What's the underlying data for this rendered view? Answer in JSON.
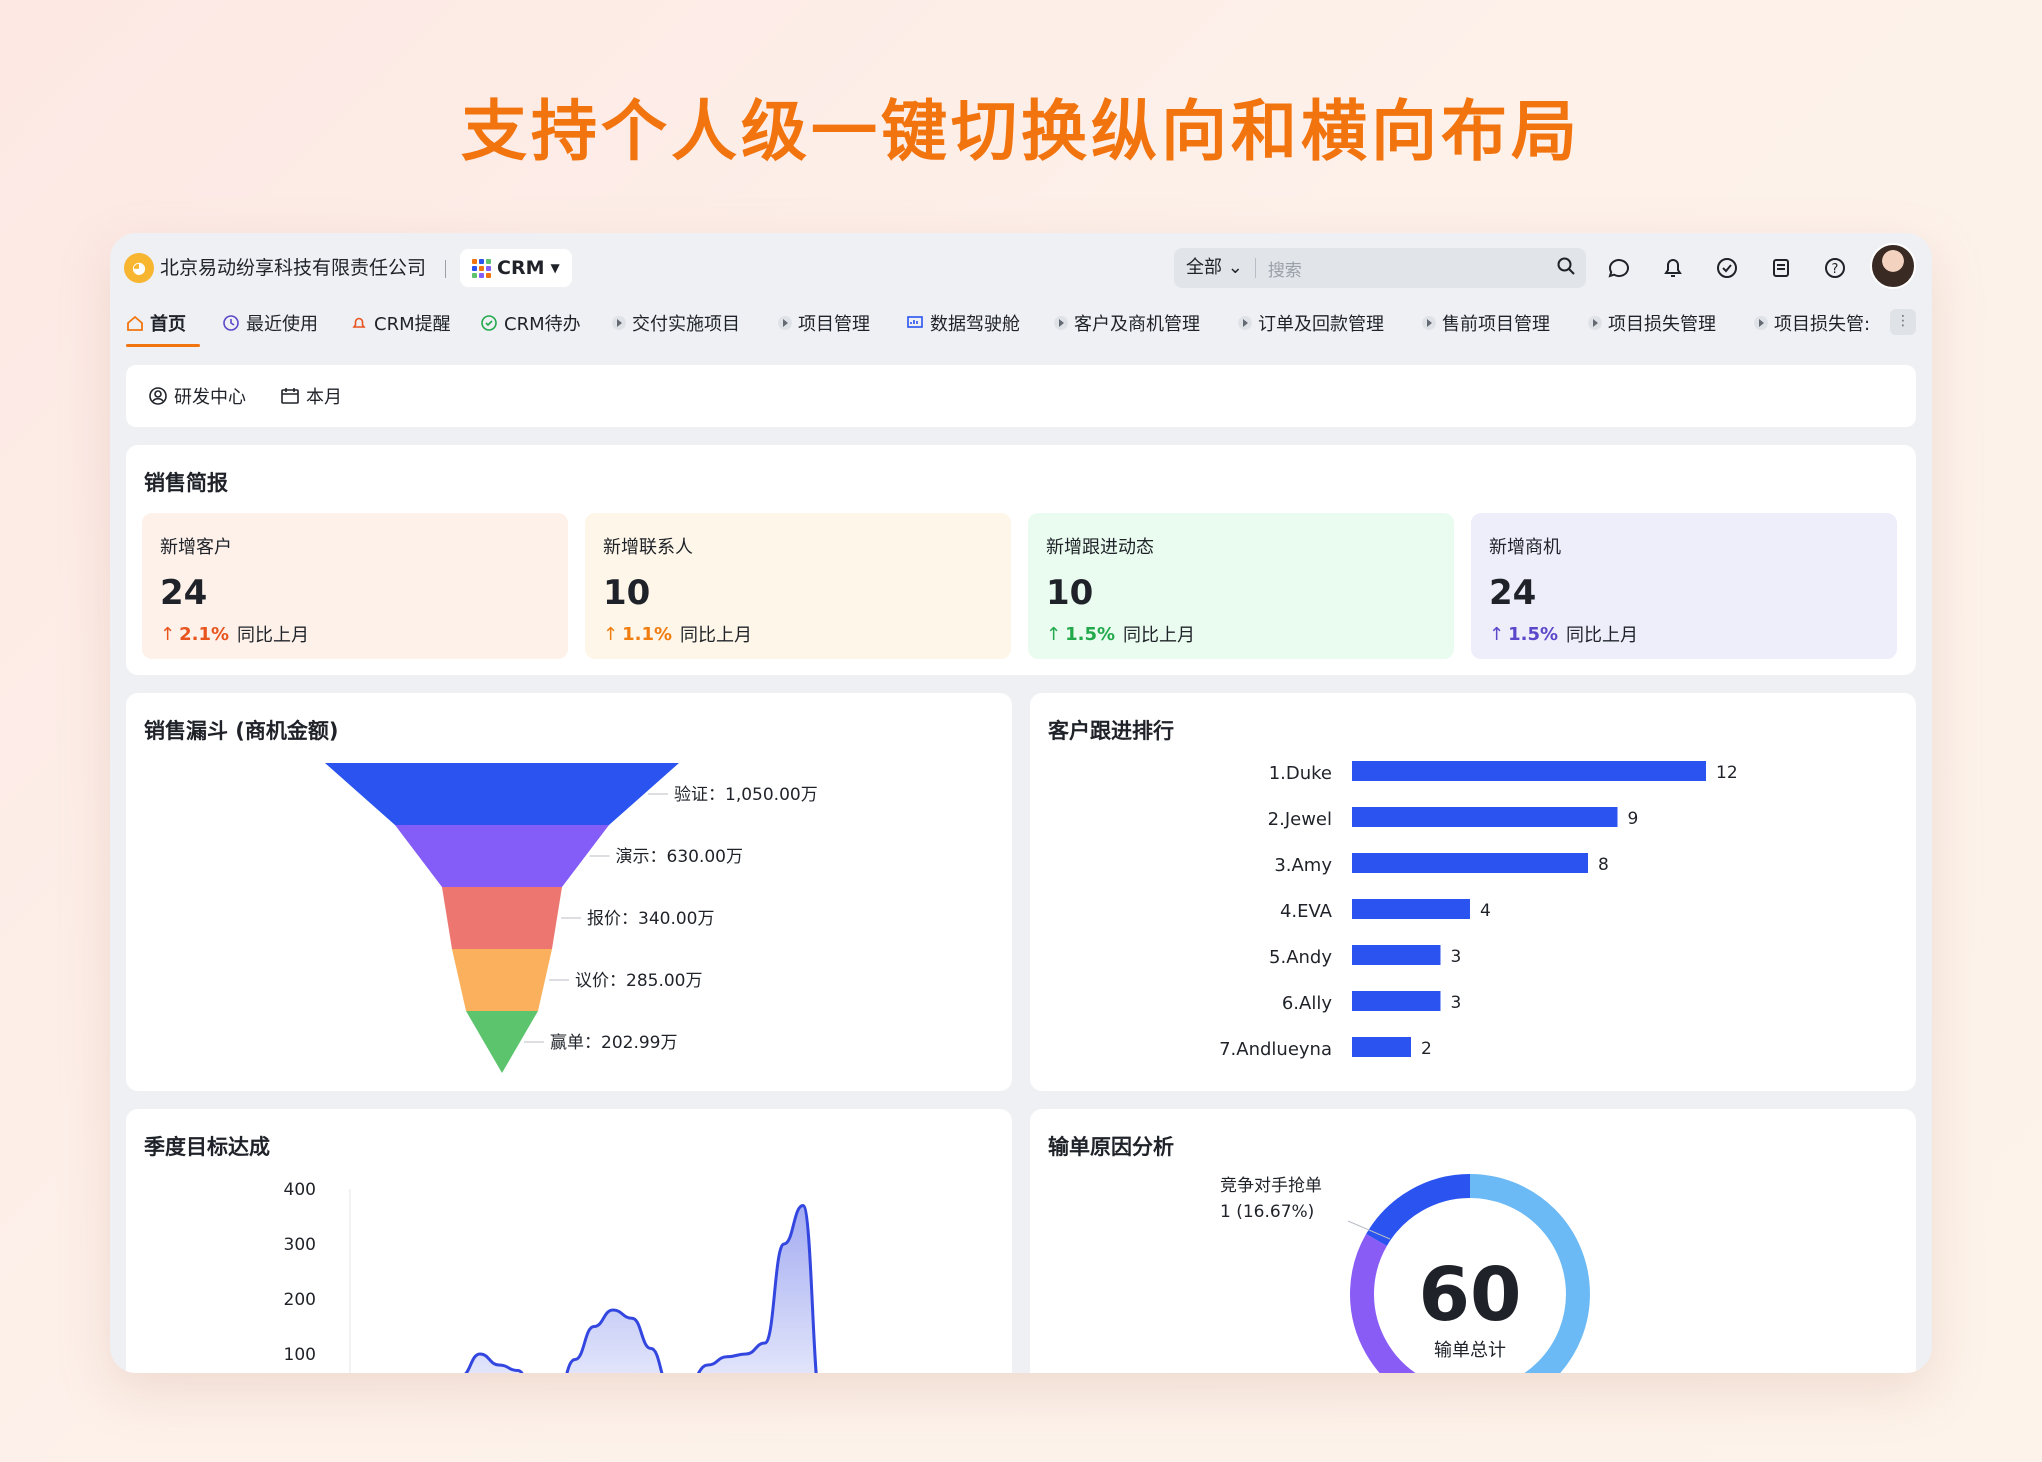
{
  "headline": "支持个人级一键切换纵向和横向布局",
  "topbar": {
    "company": "北京易动纷享科技有限责任公司",
    "app_label": "CRM",
    "search_scope": "全部",
    "search_placeholder": "搜索"
  },
  "nav": {
    "tabs": [
      {
        "label": "首页",
        "icon": "home-icon"
      },
      {
        "label": "最近使用",
        "icon": "clock-icon"
      },
      {
        "label": "CRM提醒",
        "icon": "bell-icon"
      },
      {
        "label": "CRM待办",
        "icon": "check-circle-icon"
      },
      {
        "label": "交付实施项目",
        "icon": "play-icon"
      },
      {
        "label": "项目管理",
        "icon": "play-icon"
      },
      {
        "label": "数据驾驶舱",
        "icon": "dashboard-icon"
      },
      {
        "label": "客户及商机管理",
        "icon": "play-icon"
      },
      {
        "label": "订单及回款管理",
        "icon": "play-icon"
      },
      {
        "label": "售前项目管理",
        "icon": "play-icon"
      },
      {
        "label": "项目损失管理",
        "icon": "play-icon"
      },
      {
        "label": "项目损失管:",
        "icon": "play-icon"
      }
    ]
  },
  "filters": {
    "department": "研发中心",
    "period": "本月"
  },
  "sales_brief": {
    "title": "销售简报",
    "stats": [
      {
        "label": "新增客户",
        "value": "24",
        "change": "2.1%",
        "compare": "同比上月",
        "color": "#e8541e",
        "bg": "#fdf1ea"
      },
      {
        "label": "新增联系人",
        "value": "10",
        "change": "1.1%",
        "compare": "同比上月",
        "color": "#f07d10",
        "bg": "#fef6e8"
      },
      {
        "label": "新增跟进动态",
        "value": "10",
        "change": "1.5%",
        "compare": "同比上月",
        "color": "#22a94c",
        "bg": "#eafbef"
      },
      {
        "label": "新增商机",
        "value": "24",
        "change": "1.5%",
        "compare": "同比上月",
        "color": "#5b47c9",
        "bg": "#eeeefb"
      }
    ]
  },
  "funnel": {
    "title": "销售漏斗 (商机金额)",
    "stages": [
      {
        "label": "验证：1,050.00万",
        "color": "#2a53f0"
      },
      {
        "label": "演示：630.00万",
        "color": "#845cf7"
      },
      {
        "label": "报价：340.00万",
        "color": "#ee7670"
      },
      {
        "label": "议价：285.00万",
        "color": "#fbb05d"
      },
      {
        "label": "赢单：202.99万",
        "color": "#5bc46c"
      }
    ]
  },
  "ranking": {
    "title": "客户跟进排行",
    "chart_data": {
      "type": "bar",
      "orientation": "horizontal",
      "categories": [
        "1.Duke",
        "2.Jewel",
        "3.Amy",
        "4.EVA",
        "5.Andy",
        "6.Ally",
        "7.Andlueyna"
      ],
      "values": [
        12,
        9,
        8,
        4,
        3,
        3,
        2
      ],
      "color": "#2a53f0"
    }
  },
  "quarterly": {
    "title": "季度目标达成",
    "chart_data": {
      "type": "area",
      "yticks": [
        "400",
        "300",
        "200",
        "100"
      ],
      "ylim": [
        0,
        400
      ],
      "x": [
        0,
        1,
        2,
        3,
        4,
        5,
        6,
        7,
        8,
        9,
        10,
        11,
        12,
        13,
        14,
        15,
        16,
        17,
        18,
        19,
        20
      ],
      "values": [
        0,
        60,
        100,
        80,
        70,
        0,
        20,
        90,
        150,
        180,
        165,
        110,
        40,
        50,
        80,
        95,
        100,
        120,
        300,
        370,
        0
      ],
      "color": "#3346e0"
    }
  },
  "loss": {
    "title": "输单原因分析",
    "annotation_line1": "竞争对手抢单",
    "annotation_line2": "1 (16.67%)",
    "center_value": "60",
    "center_label": "输单总计",
    "chart_data": {
      "type": "pie",
      "donut": true,
      "slices": [
        {
          "label": "竞争对手抢单",
          "value": 16.67,
          "color": "#2a53f0"
        },
        {
          "label": "",
          "value": 50,
          "color": "#6bb9f5"
        },
        {
          "label": "",
          "value": 33.33,
          "color": "#8a5cf6"
        }
      ]
    }
  }
}
